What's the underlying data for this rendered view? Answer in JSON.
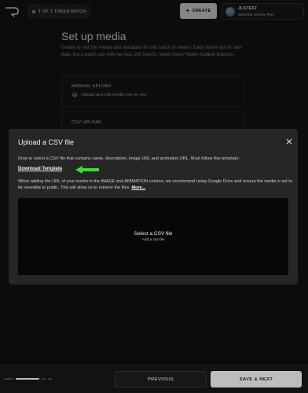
{
  "header": {
    "batch_label": "1 OF 1 TOKEN BATCH",
    "create_label": "CREATE",
    "user_name": "JLSTEST",
    "user_sub": "Manifold Johnny Test"
  },
  "page": {
    "title": "Set up media",
    "description": "Create or edit the media and metadata for this batch of tokens. Each token has its own data, but a batch can only be max 200 tokens. Need more? Make multiple batches."
  },
  "options": [
    {
      "title": "MANUAL UPLOAD",
      "description": "Upload and edit media one by one",
      "icon": "layers-icon"
    },
    {
      "title": "CSV UPLOAD",
      "description": "",
      "icon": "file-icon"
    }
  ],
  "modal": {
    "title": "Upload a CSV file",
    "description": "Drop or select a CSV file that contains name, description, image URL and animation URL. Must follow this template:",
    "download_label": "Download Template",
    "info_text": "When adding the URL of your media to the IMAGE and ANIMATION column, we recommend using Google Drive and ensure the media is set to be viewable to public. This will allow us to retrieve the files.",
    "more_label": "More...",
    "dropzone_title": "Select a CSV file",
    "dropzone_sub": "Add a csv file"
  },
  "footer": {
    "previous_label": "PREVIOUS",
    "next_label": "SAVE & NEXT",
    "progress_steps": 4,
    "progress_active_step": 2
  },
  "colors": {
    "annotation_arrow": "#2ee62e",
    "batch_dot": "#e88a3a"
  }
}
